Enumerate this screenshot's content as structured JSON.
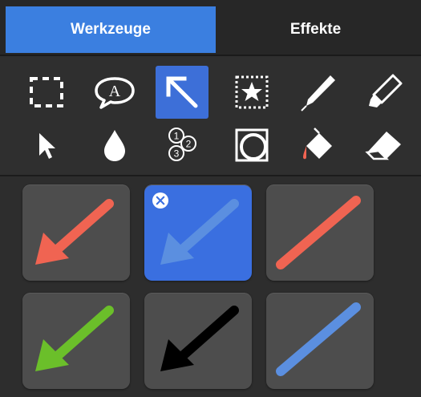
{
  "tabs": [
    {
      "label": "Werkzeuge",
      "active": true
    },
    {
      "label": "Effekte",
      "active": false
    }
  ],
  "tools": [
    {
      "icon": "marquee-select-icon",
      "selected": false
    },
    {
      "icon": "speech-bubble-text-icon",
      "selected": false
    },
    {
      "icon": "arrow-tool-icon",
      "selected": true
    },
    {
      "icon": "stamp-icon",
      "selected": false
    },
    {
      "icon": "pen-icon",
      "selected": false
    },
    {
      "icon": "highlighter-icon",
      "selected": false
    },
    {
      "icon": "pointer-icon",
      "selected": false
    },
    {
      "icon": "blur-drop-icon",
      "selected": false
    },
    {
      "icon": "numbered-steps-icon",
      "selected": false
    },
    {
      "icon": "magnifier-shape-icon",
      "selected": false
    },
    {
      "icon": "paint-bucket-icon",
      "selected": false
    },
    {
      "icon": "eraser-icon",
      "selected": false
    }
  ],
  "steps_numbers": [
    "1",
    "2",
    "3"
  ],
  "text_bubble_letter": "A",
  "colors": {
    "accent": "#3b7fe0",
    "red": "#f06452",
    "blue": "#5b8fe0",
    "green": "#6bbf2a",
    "black": "#000000"
  },
  "presets": [
    {
      "style": "arrow",
      "color": "#f06452",
      "selected": false
    },
    {
      "style": "arrow",
      "color": "#5b8fe0",
      "selected": true
    },
    {
      "style": "line",
      "color": "#f06452",
      "selected": false
    },
    {
      "style": "arrow",
      "color": "#6bbf2a",
      "selected": false
    },
    {
      "style": "arrow",
      "color": "#000000",
      "selected": false
    },
    {
      "style": "line",
      "color": "#5b8fe0",
      "selected": false
    }
  ]
}
